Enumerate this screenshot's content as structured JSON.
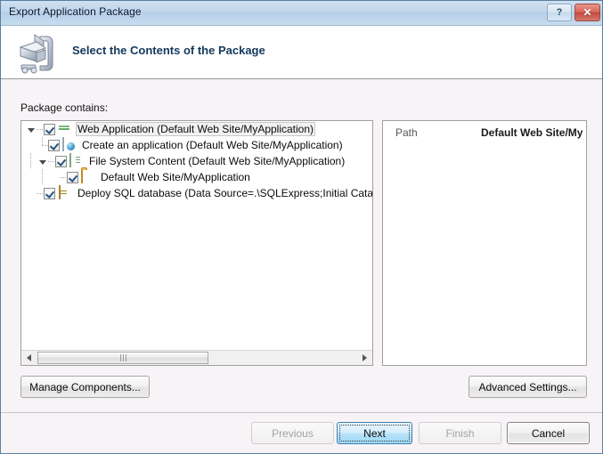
{
  "window": {
    "title": "Export Application Package",
    "help_button": "?",
    "close_button": "✕"
  },
  "header": {
    "title": "Select the Contents of the Package",
    "icon": "export-package-icon"
  },
  "main": {
    "package_label": "Package contains:",
    "tree": [
      {
        "label": "Web Application (Default Web Site/MyApplication)",
        "icon": "globe-icon",
        "checked": true,
        "expander": "expanded",
        "selected": true,
        "depth": 0
      },
      {
        "label": "Create an application (Default Web Site/MyApplication)",
        "icon": "application-icon",
        "checked": true,
        "expander": "none",
        "selected": false,
        "depth": 1
      },
      {
        "label": "File System Content (Default Web Site/MyApplication)",
        "icon": "file-content-icon",
        "checked": true,
        "expander": "expanded",
        "selected": false,
        "depth": 1
      },
      {
        "label": "Default Web Site/MyApplication",
        "icon": "folder-icon",
        "checked": true,
        "expander": "collapsed",
        "selected": false,
        "depth": 2
      },
      {
        "label": "Deploy SQL database (Data Source=.\\SQLExpress;Initial Catalog=",
        "icon": "database-icon",
        "checked": true,
        "expander": "collapsed",
        "selected": false,
        "depth": 0
      }
    ],
    "scrollbar": {
      "left_arrow": "◄",
      "right_arrow": "►"
    },
    "path_panel": {
      "key": "Path",
      "value": "Default Web Site/My"
    },
    "manage_components_label": "Manage Components...",
    "advanced_settings_label": "Advanced Settings..."
  },
  "footer": {
    "previous_label": "Previous",
    "next_label": "Next",
    "finish_label": "Finish",
    "cancel_label": "Cancel"
  },
  "colors": {
    "titlebar": "#c0d6ec",
    "body": "#f7f3f7",
    "accent_focus": "#b7e3f9",
    "close_red": "#c44a3c",
    "header_title": "#14395c"
  }
}
